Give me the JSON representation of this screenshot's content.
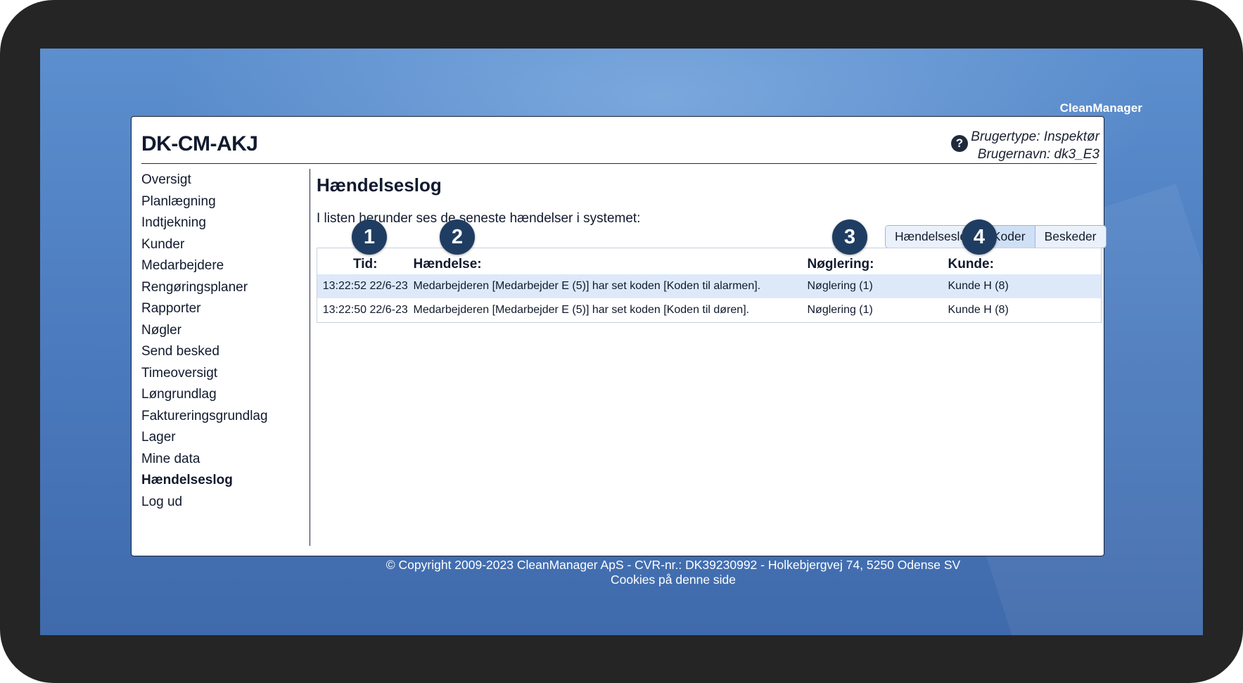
{
  "brand": "CleanManager",
  "header": {
    "site_title": "DK-CM-AKJ",
    "user_type": "Brugertype: Inspektør",
    "user_name": "Brugernavn: dk3_E3",
    "help_icon": "question-circle-icon"
  },
  "sidebar": {
    "items": [
      {
        "label": "Oversigt"
      },
      {
        "label": "Planlægning"
      },
      {
        "label": "Indtjekning"
      },
      {
        "label": "Kunder"
      },
      {
        "label": "Medarbejdere"
      },
      {
        "label": "Rengøringsplaner"
      },
      {
        "label": "Rapporter"
      },
      {
        "label": "Nøgler"
      },
      {
        "label": "Send besked"
      },
      {
        "label": "Timeoversigt"
      },
      {
        "label": "Løngrundlag"
      },
      {
        "label": "Faktureringsgrundlag"
      },
      {
        "label": "Lager"
      },
      {
        "label": "Mine data"
      },
      {
        "label": "Hændelseslog",
        "active": true
      },
      {
        "label": "Log ud"
      }
    ]
  },
  "main": {
    "title": "Hændelseslog",
    "intro": "I listen herunder ses de seneste hændelser i systemet:",
    "tabs": [
      {
        "label": "Hændelseslog"
      },
      {
        "label": "Koder",
        "selected": true
      },
      {
        "label": "Beskeder"
      }
    ],
    "table": {
      "columns": [
        "Tid:",
        "Hændelse:",
        "Nøglering:",
        "Kunde:"
      ],
      "rows": [
        {
          "time": "13:22:52 22/6-23",
          "event": "Medarbejderen [Medarbejder E (5)] har set koden [Koden til alarmen].",
          "keyring": "Nøglering (1)",
          "customer": "Kunde H (8)"
        },
        {
          "time": "13:22:50 22/6-23",
          "event": "Medarbejderen [Medarbejder E (5)] har set koden [Koden til døren].",
          "keyring": "Nøglering (1)",
          "customer": "Kunde H (8)"
        }
      ]
    }
  },
  "badges": [
    "1",
    "2",
    "3",
    "4"
  ],
  "footer": {
    "copyright": "© Copyright 2009-2023 CleanManager ApS - CVR-nr.: DK39230992 - Holkebjergvej 74, 5250 Odense SV",
    "cookies": "Cookies på denne side"
  }
}
